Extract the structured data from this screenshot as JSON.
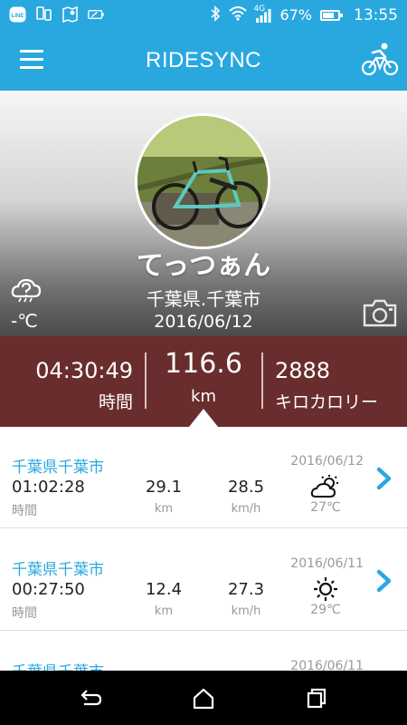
{
  "status_bar": {
    "battery_percent": "67%",
    "battery_level": 0.67,
    "network": "4G",
    "time": "13:55",
    "left_icons": [
      "line-icon",
      "phone-sync-icon",
      "map-icon",
      "battery-saver-icon"
    ]
  },
  "app_bar": {
    "title": "RIDESYNC",
    "color": "#29a8e0"
  },
  "profile": {
    "username": "てっつぁん",
    "location": "千葉県.千葉市",
    "date": "2016/06/12",
    "temperature": "-℃",
    "weather_icon": "weather-unknown-icon"
  },
  "stats": {
    "duration": "04:30:49",
    "duration_label": "時間",
    "distance": "116.6",
    "distance_unit": "km",
    "calories": "2888",
    "calories_label": "キロカロリー",
    "color": "#6a2d2d"
  },
  "rides": [
    {
      "location": "千葉県千葉市",
      "date": "2016/06/12",
      "duration": "01:02:28",
      "duration_label": "時間",
      "distance": "29.1",
      "distance_unit": "km",
      "speed": "28.5",
      "speed_unit": "km/h",
      "weather_icon": "partly-cloudy-icon",
      "temperature": "27℃"
    },
    {
      "location": "千葉県千葉市",
      "date": "2016/06/11",
      "duration": "00:27:50",
      "duration_label": "時間",
      "distance": "12.4",
      "distance_unit": "km",
      "speed": "27.3",
      "speed_unit": "km/h",
      "weather_icon": "sunny-icon",
      "temperature": "29℃"
    },
    {
      "location": "千葉県千葉市",
      "date": "2016/06/11"
    }
  ],
  "nav_bar": {
    "buttons": [
      "back-icon",
      "home-icon",
      "recents-icon"
    ]
  }
}
